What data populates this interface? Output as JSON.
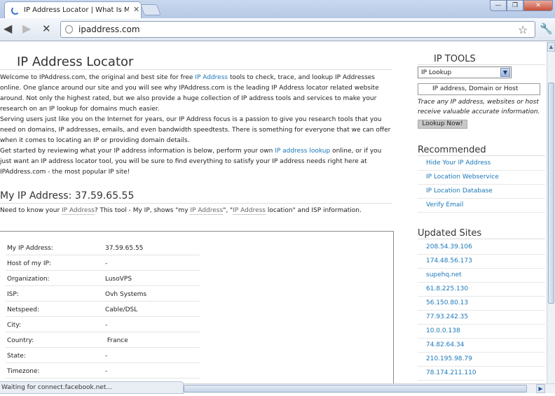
{
  "browser": {
    "tab_title": "IP Address Locator | What Is M",
    "url": "ipaddress.com"
  },
  "main": {
    "title": "IP Address Locator",
    "intro": {
      "p1_a": "Welcome to IPAddress.com, the original and best site for free ",
      "p1_link": "IP Address",
      "p1_b": " tools to check, trace, and lookup IP Addresses online. One glance around our site and you will see why IPAddress.com is the leading IP Address locator related website around. Not only the highest rated, but we also provide a huge collection of IP address tools and services to make your research on an IP lookup for domains much easier.",
      "p2": "Serving users just like you on the Internet for years, our IP Address focus is a passion to give you research tools that you need on domains, IP addresses, emails, and even bandwidth speedtests. There is something for everyone that we can offer when it comes to locating an IP or providing domain details.",
      "p3_a": "Get started by reviewing what your IP address information is below, perform your own ",
      "p3_link": "IP address lookup",
      "p3_b": " online, or if you just want an IP address locator tool, you will be sure to find everything to satisfy your IP address needs right here at IPAddress.com - the most popular IP site!"
    },
    "myip_heading": "My IP Address: 37.59.65.55",
    "myip_desc": {
      "a": "Need to know your ",
      "link1": "IP Address",
      "b": "? This tool - My IP, shows \"my ",
      "link2": "IP Address",
      "c": "\", \"",
      "link3": "IP Address",
      "d": " location\" and ISP information."
    },
    "info_rows": [
      {
        "label": "My IP Address:",
        "value": "37.59.65.55"
      },
      {
        "label": "Host of my IP:",
        "value": "-"
      },
      {
        "label": "Organization:",
        "value": "LusoVPS"
      },
      {
        "label": "ISP:",
        "value": "Ovh Systems"
      },
      {
        "label": "Netspeed:",
        "value": "Cable/DSL"
      },
      {
        "label": "City:",
        "value": "-"
      },
      {
        "label": "Country:",
        "value": " France"
      },
      {
        "label": "State:",
        "value": "-"
      },
      {
        "label": "Timezone:",
        "value": "-"
      }
    ]
  },
  "sidebar": {
    "tools_title": "IP TOOLS",
    "tools_select": "IP Lookup",
    "tools_input": "IP address, Domain or Host",
    "tools_note": "Trace any IP address, websites or host receive valuable accurate information.",
    "lookup_button": "Lookup Now!",
    "recommended_title": "Recommended",
    "recommended": [
      "Hide Your IP Address",
      "IP Location Webservice",
      "IP Location Database",
      "Verify Email"
    ],
    "updated_title": "Updated Sites",
    "updated": [
      "208.54.39.106",
      "174.48.56.173",
      "supehq.net",
      "61.8.225.130",
      "56.150.80.13",
      "77.93.242.35",
      "10.0.0.138",
      "74.82.64.34",
      "210.195.98.79",
      "78.174.211.110"
    ]
  },
  "status_text": "Waiting for connect.facebook.net..."
}
